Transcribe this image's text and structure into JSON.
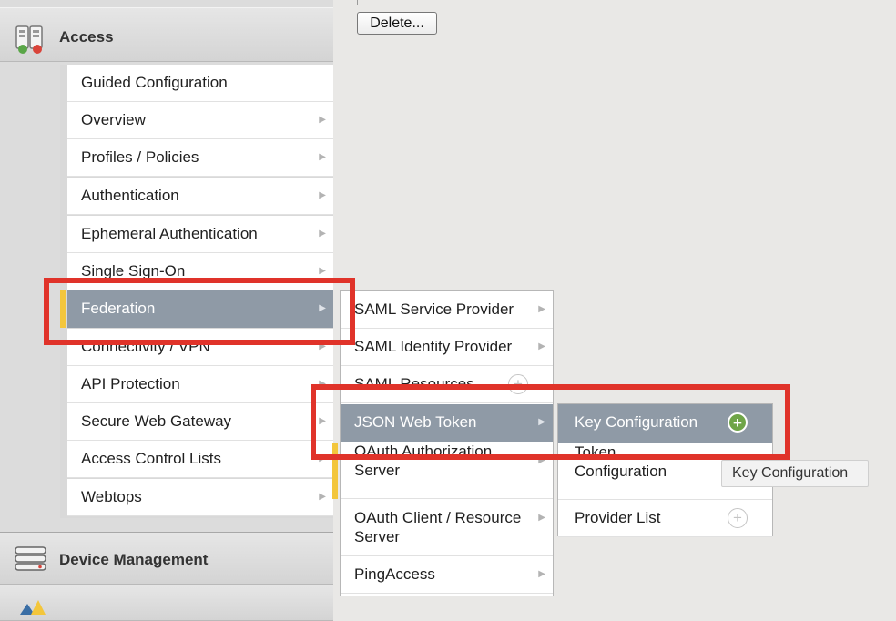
{
  "toolbar": {
    "delete_label": "Delete..."
  },
  "sidebar": {
    "access_title": "Access",
    "device_title": "Device Management",
    "menu": [
      {
        "label": "Guided Configuration",
        "has_arrow": false
      },
      {
        "label": "Overview",
        "has_arrow": true
      },
      {
        "label": "Profiles / Policies",
        "has_arrow": true
      },
      {
        "label": "Authentication",
        "has_arrow": true
      },
      {
        "label": "Ephemeral Authentication",
        "has_arrow": true
      },
      {
        "label": "Single Sign-On",
        "has_arrow": true
      },
      {
        "label": "Federation",
        "has_arrow": true,
        "active": true
      },
      {
        "label": "Connectivity / VPN",
        "has_arrow": true
      },
      {
        "label": "API Protection",
        "has_arrow": true
      },
      {
        "label": "Secure Web Gateway",
        "has_arrow": true
      },
      {
        "label": "Access Control Lists",
        "has_arrow": true
      },
      {
        "label": "Webtops",
        "has_arrow": true
      }
    ]
  },
  "federation_menu": [
    {
      "label": "SAML Service Provider"
    },
    {
      "label": "SAML Identity Provider"
    },
    {
      "label": "SAML Resources"
    },
    {
      "label": "JSON Web Token",
      "active": true
    },
    {
      "label": "OAuth Authorization Server"
    },
    {
      "label": "OAuth Client / Resource Server"
    },
    {
      "label": "PingAccess"
    }
  ],
  "jwt_menu": [
    {
      "label": "Key Configuration",
      "active": true
    },
    {
      "label": "Token Configuration"
    },
    {
      "label": "Provider List"
    }
  ],
  "tooltip": {
    "text": "Key Configuration"
  },
  "icons": {
    "add": "+",
    "arrow": "▶"
  },
  "colors": {
    "highlight": "#e0332a",
    "active_bg": "#8f9aa6",
    "marker": "#f3c63c",
    "add_green": "#6fa548"
  }
}
